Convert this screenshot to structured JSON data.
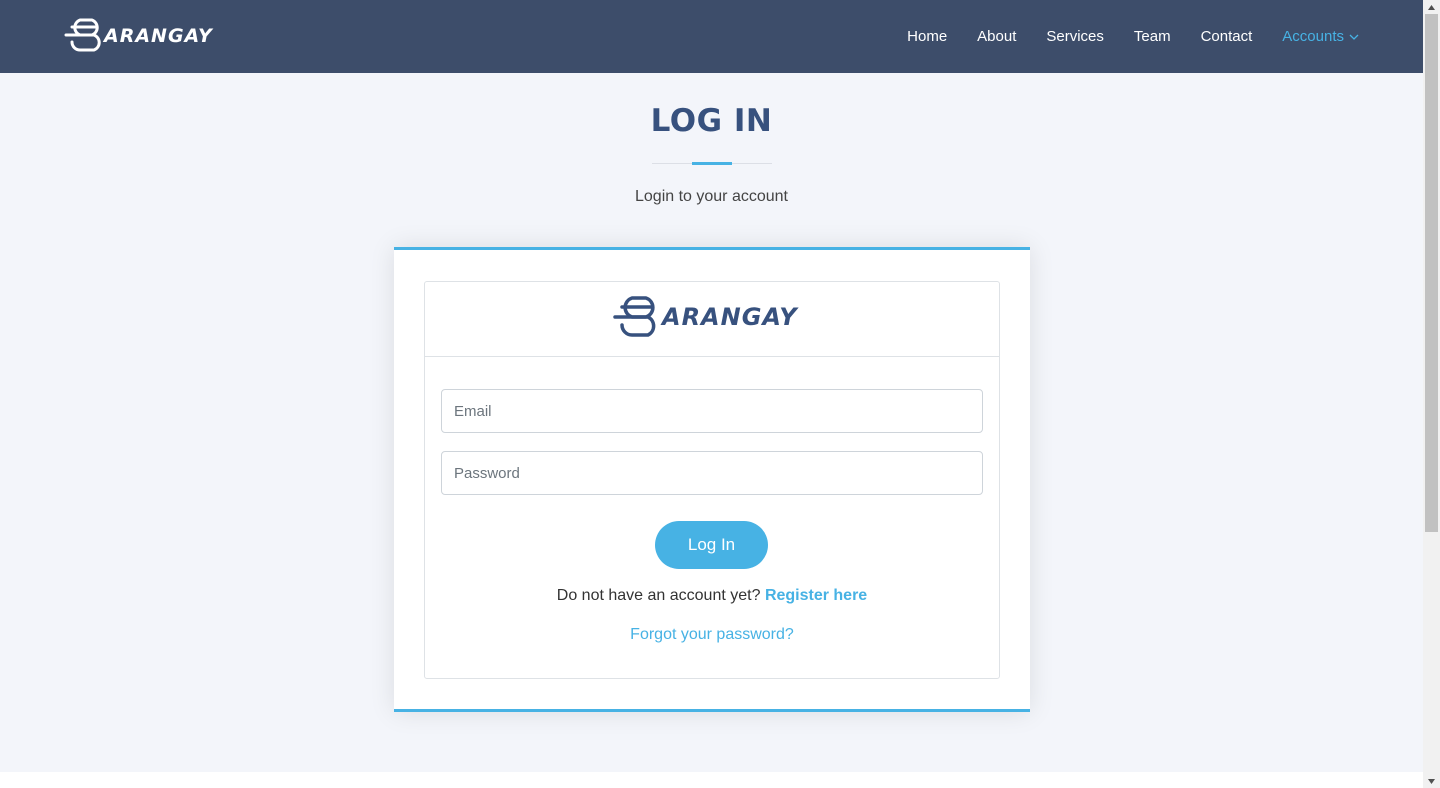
{
  "header": {
    "logo_text": "BARANGAY",
    "nav": [
      {
        "label": "Home"
      },
      {
        "label": "About"
      },
      {
        "label": "Services"
      },
      {
        "label": "Team"
      },
      {
        "label": "Contact"
      },
      {
        "label": "Accounts",
        "active": true
      }
    ]
  },
  "section": {
    "title": "LOG IN",
    "subtitle": "Login to your account"
  },
  "login": {
    "logo_text": "BARANGAY",
    "email_placeholder": "Email",
    "password_placeholder": "Password",
    "submit_label": "Log In",
    "register_prompt": "Do not have an account yet?",
    "register_link": "Register here",
    "forgot_link": "Forgot your password?"
  },
  "colors": {
    "header_bg": "#3d4d6a",
    "accent": "#47b2e4",
    "title": "#37517e",
    "page_bg": "#f3f5fa"
  }
}
